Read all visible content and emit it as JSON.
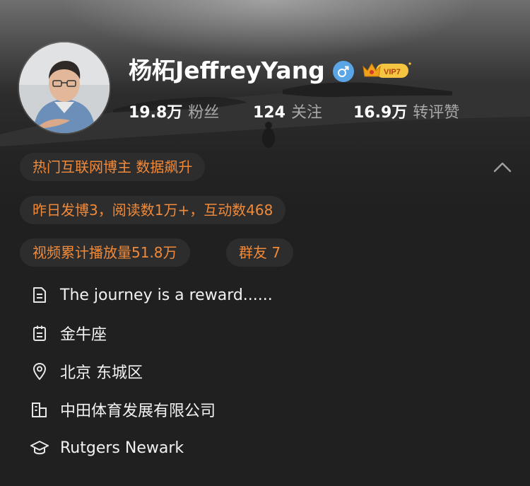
{
  "profile": {
    "name": "杨柘JeffreyYang",
    "gender_icon": "male-icon",
    "vip_label": "VIP7",
    "stats": [
      {
        "value": "19.8万",
        "label": "粉丝"
      },
      {
        "value": "124",
        "label": "关注"
      },
      {
        "value": "16.9万",
        "label": "转评赞"
      }
    ]
  },
  "tags": {
    "hot_blogger": "热门互联网博主 数据飙升",
    "yesterday": "昨日发博3，阅读数1万+，互动数468",
    "video_plays": "视频累计播放量51.8万",
    "group_friends": "群友 7"
  },
  "info": {
    "bio": "The journey is a reward......",
    "zodiac": "金牛座",
    "location": "北京 东城区",
    "company": "中田体育发展有限公司",
    "school": "Rutgers Newark"
  },
  "colors": {
    "accent_orange": "#f08a3a",
    "background": "#202020",
    "chip_background": "#2d2d2d",
    "gender_blue": "#5aa5e6",
    "vip_gold": "#f5c542"
  }
}
